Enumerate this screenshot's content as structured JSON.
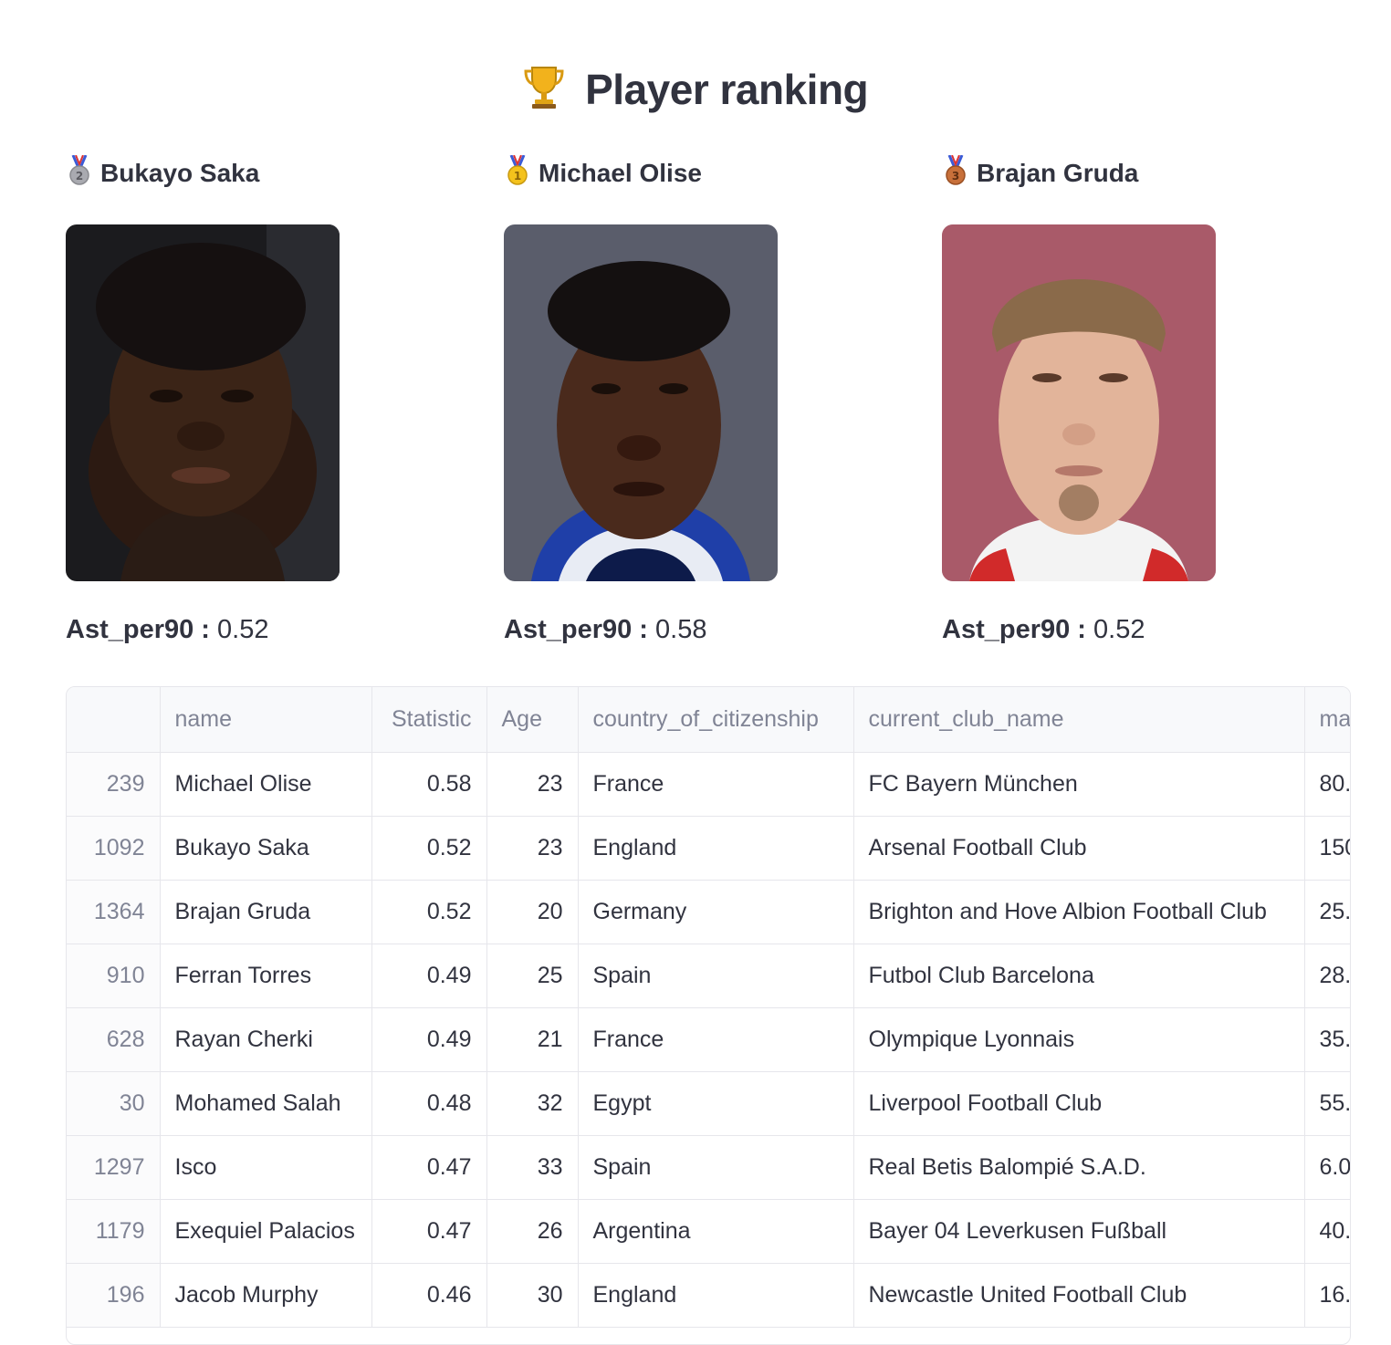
{
  "title": "Player ranking",
  "podium": [
    {
      "rank": 2,
      "medal": "silver-medal-icon",
      "name": "Bukayo Saka",
      "stat_label": "Ast_per90 :",
      "stat_value": "0.52"
    },
    {
      "rank": 1,
      "medal": "gold-medal-icon",
      "name": "Michael Olise",
      "stat_label": "Ast_per90 :",
      "stat_value": "0.58"
    },
    {
      "rank": 3,
      "medal": "bronze-medal-icon",
      "name": "Brajan Gruda",
      "stat_label": "Ast_per90 :",
      "stat_value": "0.52"
    }
  ],
  "table": {
    "columns": [
      "",
      "name",
      "Statistic",
      "Age",
      "country_of_citizenship",
      "current_club_name",
      "ma"
    ],
    "rows": [
      {
        "idx": "239",
        "name": "Michael Olise",
        "statistic": "0.58",
        "age": "23",
        "country": "France",
        "club": "FC Bayern München",
        "ma": "80."
      },
      {
        "idx": "1092",
        "name": "Bukayo Saka",
        "statistic": "0.52",
        "age": "23",
        "country": "England",
        "club": "Arsenal Football Club",
        "ma": "150"
      },
      {
        "idx": "1364",
        "name": "Brajan Gruda",
        "statistic": "0.52",
        "age": "20",
        "country": "Germany",
        "club": "Brighton and Hove Albion Football Club",
        "ma": "25."
      },
      {
        "idx": "910",
        "name": "Ferran Torres",
        "statistic": "0.49",
        "age": "25",
        "country": "Spain",
        "club": "Futbol Club Barcelona",
        "ma": "28."
      },
      {
        "idx": "628",
        "name": "Rayan Cherki",
        "statistic": "0.49",
        "age": "21",
        "country": "France",
        "club": "Olympique Lyonnais",
        "ma": "35."
      },
      {
        "idx": "30",
        "name": "Mohamed Salah",
        "statistic": "0.48",
        "age": "32",
        "country": "Egypt",
        "club": "Liverpool Football Club",
        "ma": "55."
      },
      {
        "idx": "1297",
        "name": "Isco",
        "statistic": "0.47",
        "age": "33",
        "country": "Spain",
        "club": "Real Betis Balompié S.A.D.",
        "ma": "6.0"
      },
      {
        "idx": "1179",
        "name": "Exequiel Palacios",
        "statistic": "0.47",
        "age": "26",
        "country": "Argentina",
        "club": "Bayer 04 Leverkusen Fußball",
        "ma": "40."
      },
      {
        "idx": "196",
        "name": "Jacob Murphy",
        "statistic": "0.46",
        "age": "30",
        "country": "England",
        "club": "Newcastle United Football Club",
        "ma": "16."
      }
    ]
  },
  "colors": {
    "text": "#31333f",
    "muted": "#808495",
    "border": "#e6e6eb",
    "header_bg": "#f8f9fb"
  }
}
